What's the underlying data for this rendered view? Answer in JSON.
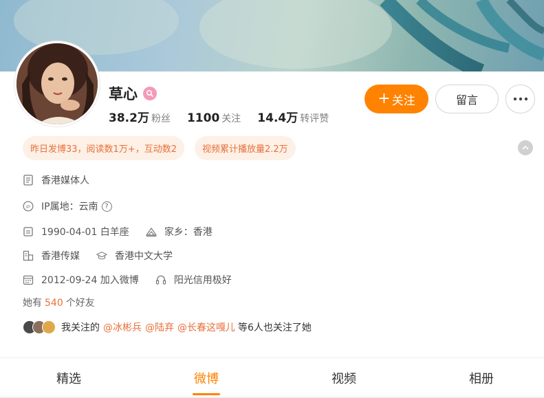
{
  "profile": {
    "name": "草心",
    "badge_icon": "verified-v-icon"
  },
  "stats": [
    {
      "num": "38.2万",
      "label": "粉丝"
    },
    {
      "num": "1100",
      "label": "关注"
    },
    {
      "num": "14.4万",
      "label": "转评赞"
    }
  ],
  "actions": {
    "follow_plus": "+",
    "follow_label": "关注",
    "message_label": "留言",
    "more_icon": "more-dots-icon"
  },
  "pills": [
    "昨日发博33，阅读数1万+，互动数2",
    "视频累计播放量2.2万"
  ],
  "info": {
    "bio": "香港媒体人",
    "ip": "IP属地：云南",
    "birthday": "1990-04-01 白羊座",
    "hometown": "家乡：香港",
    "company": "香港传媒",
    "school": "香港中文大学",
    "joined": "2012-09-24 加入微博",
    "credit": "阳光信用极好",
    "help_mark": "?"
  },
  "friends": {
    "prefix": "她有",
    "count": "540",
    "suffix": "个好友"
  },
  "mutual": {
    "prefix": "我关注的",
    "users": [
      "@冰彬兵",
      "@陆弃",
      "@长春这嘎儿"
    ],
    "suffix": "等6人也关注了她"
  },
  "tabs": [
    {
      "label": "精选",
      "active": false
    },
    {
      "label": "微博",
      "active": true
    },
    {
      "label": "视频",
      "active": false
    },
    {
      "label": "相册",
      "active": false
    }
  ],
  "colors": {
    "accent": "#ff8200",
    "pill_text": "#e8703a",
    "pill_bg": "#fdf0e6",
    "badge": "#f49ab6"
  }
}
